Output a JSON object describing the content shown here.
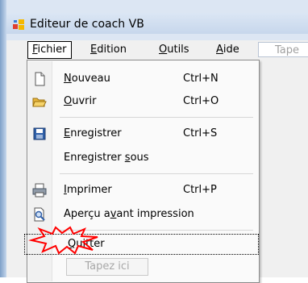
{
  "window": {
    "title": "Editeur de coach VB"
  },
  "menubar": {
    "items": [
      {
        "label": "Fichier",
        "mnemonic": "F"
      },
      {
        "label": "Edition",
        "mnemonic": "E"
      },
      {
        "label": "Outils",
        "mnemonic": "O"
      },
      {
        "label": "Aide",
        "mnemonic": "A"
      }
    ],
    "type_here": "Tape"
  },
  "fichier_menu": {
    "items": [
      {
        "label": "Nouveau",
        "shortcut": "Ctrl+N",
        "icon": "new-document-icon"
      },
      {
        "label": "Ouvrir",
        "shortcut": "Ctrl+O",
        "icon": "open-folder-icon"
      },
      {
        "label": "Enregistrer",
        "shortcut": "Ctrl+S",
        "icon": "save-disk-icon"
      },
      {
        "label": "Enregistrer sous",
        "shortcut": "",
        "icon": ""
      },
      {
        "label": "Imprimer",
        "shortcut": "Ctrl+P",
        "icon": "printer-icon"
      },
      {
        "label": "Aperçu avant impression",
        "shortcut": "",
        "icon": "print-preview-icon"
      },
      {
        "label": "Quitter",
        "shortcut": "",
        "icon": ""
      }
    ],
    "type_here": "Tapez ici"
  },
  "colors": {
    "burst_outline": "#ff0000",
    "titlebar": "#dbe6f4",
    "menu_background": "#fafafa"
  }
}
